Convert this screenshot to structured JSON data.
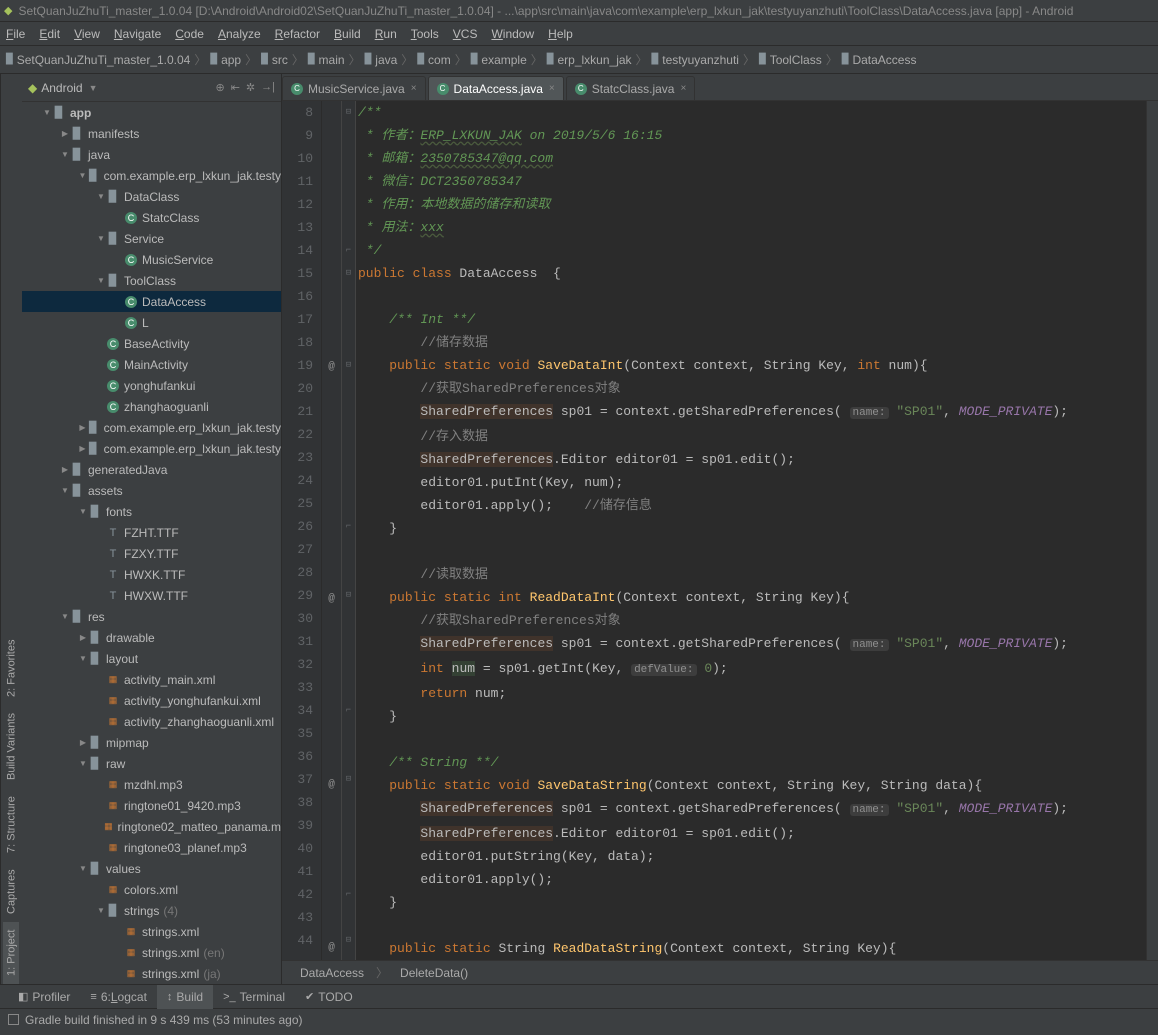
{
  "title": "SetQuanJuZhuTi_master_1.0.04 [D:\\Android\\Android02\\SetQuanJuZhuTi_master_1.0.04] - ...\\app\\src\\main\\java\\com\\example\\erp_lxkun_jak\\testyuyanzhuti\\ToolClass\\DataAccess.java [app] - Android",
  "menu": [
    "File",
    "Edit",
    "View",
    "Navigate",
    "Code",
    "Analyze",
    "Refactor",
    "Build",
    "Run",
    "Tools",
    "VCS",
    "Window",
    "Help"
  ],
  "breadcrumbs": [
    "SetQuanJuZhuTi_master_1.0.04",
    "app",
    "src",
    "main",
    "java",
    "com",
    "example",
    "erp_lxkun_jak",
    "testyuyanzhuti",
    "ToolClass",
    "DataAccess"
  ],
  "leftTabs": [
    "1: Project",
    "Captures",
    "7: Structure",
    "Build Variants",
    "2: Favorites"
  ],
  "projectDropdown": "Android",
  "tree": [
    {
      "d": 0,
      "a": "▼",
      "i": "app",
      "t": "app",
      "bold": true
    },
    {
      "d": 1,
      "a": "▶",
      "i": "folder",
      "t": "manifests"
    },
    {
      "d": 1,
      "a": "▼",
      "i": "folder",
      "t": "java"
    },
    {
      "d": 2,
      "a": "▼",
      "i": "folder",
      "t": "com.example.erp_lxkun_jak.testy"
    },
    {
      "d": 3,
      "a": "▼",
      "i": "folder",
      "t": "DataClass"
    },
    {
      "d": 4,
      "a": "",
      "i": "class",
      "t": "StatcClass"
    },
    {
      "d": 3,
      "a": "▼",
      "i": "folder",
      "t": "Service"
    },
    {
      "d": 4,
      "a": "",
      "i": "class",
      "t": "MusicService"
    },
    {
      "d": 3,
      "a": "▼",
      "i": "folder",
      "t": "ToolClass"
    },
    {
      "d": 4,
      "a": "",
      "i": "class",
      "t": "DataAccess",
      "sel": true
    },
    {
      "d": 4,
      "a": "",
      "i": "class",
      "t": "L"
    },
    {
      "d": 3,
      "a": "",
      "i": "class",
      "t": "BaseActivity"
    },
    {
      "d": 3,
      "a": "",
      "i": "class",
      "t": "MainActivity"
    },
    {
      "d": 3,
      "a": "",
      "i": "class",
      "t": "yonghufankui"
    },
    {
      "d": 3,
      "a": "",
      "i": "class",
      "t": "zhanghaoguanli"
    },
    {
      "d": 2,
      "a": "▶",
      "i": "folder",
      "t": "com.example.erp_lxkun_jak.testy"
    },
    {
      "d": 2,
      "a": "▶",
      "i": "folder",
      "t": "com.example.erp_lxkun_jak.testy"
    },
    {
      "d": 1,
      "a": "▶",
      "i": "folder",
      "t": "generatedJava"
    },
    {
      "d": 1,
      "a": "▼",
      "i": "folder",
      "t": "assets"
    },
    {
      "d": 2,
      "a": "▼",
      "i": "folder",
      "t": "fonts"
    },
    {
      "d": 3,
      "a": "",
      "i": "file",
      "t": "FZHT.TTF"
    },
    {
      "d": 3,
      "a": "",
      "i": "file",
      "t": "FZXY.TTF"
    },
    {
      "d": 3,
      "a": "",
      "i": "file",
      "t": "HWXK.TTF"
    },
    {
      "d": 3,
      "a": "",
      "i": "file",
      "t": "HWXW.TTF"
    },
    {
      "d": 1,
      "a": "▼",
      "i": "folder",
      "t": "res"
    },
    {
      "d": 2,
      "a": "▶",
      "i": "folder",
      "t": "drawable"
    },
    {
      "d": 2,
      "a": "▼",
      "i": "folder",
      "t": "layout"
    },
    {
      "d": 3,
      "a": "",
      "i": "res",
      "t": "activity_main.xml"
    },
    {
      "d": 3,
      "a": "",
      "i": "res",
      "t": "activity_yonghufankui.xml"
    },
    {
      "d": 3,
      "a": "",
      "i": "res",
      "t": "activity_zhanghaoguanli.xml"
    },
    {
      "d": 2,
      "a": "▶",
      "i": "folder",
      "t": "mipmap"
    },
    {
      "d": 2,
      "a": "▼",
      "i": "folder",
      "t": "raw"
    },
    {
      "d": 3,
      "a": "",
      "i": "res",
      "t": "mzdhl.mp3"
    },
    {
      "d": 3,
      "a": "",
      "i": "res",
      "t": "ringtone01_9420.mp3"
    },
    {
      "d": 3,
      "a": "",
      "i": "res",
      "t": "ringtone02_matteo_panama.m"
    },
    {
      "d": 3,
      "a": "",
      "i": "res",
      "t": "ringtone03_planef.mp3"
    },
    {
      "d": 2,
      "a": "▼",
      "i": "folder",
      "t": "values"
    },
    {
      "d": 3,
      "a": "",
      "i": "res",
      "t": "colors.xml"
    },
    {
      "d": 3,
      "a": "▼",
      "i": "folder",
      "t": "strings",
      "hint": "(4)"
    },
    {
      "d": 4,
      "a": "",
      "i": "res",
      "t": "strings.xml"
    },
    {
      "d": 4,
      "a": "",
      "i": "res",
      "t": "strings.xml",
      "hint": "(en)"
    },
    {
      "d": 4,
      "a": "",
      "i": "res",
      "t": "strings.xml",
      "hint": "(ja)"
    }
  ],
  "editorTabs": [
    {
      "name": "MusicService.java"
    },
    {
      "name": "DataAccess.java",
      "active": true
    },
    {
      "name": "StatcClass.java"
    }
  ],
  "code": {
    "lines": [
      8,
      9,
      10,
      11,
      12,
      13,
      14,
      15,
      16,
      17,
      18,
      19,
      20,
      21,
      22,
      23,
      24,
      25,
      26,
      27,
      28,
      29,
      30,
      31,
      32,
      33,
      34,
      35,
      36,
      37,
      38,
      39,
      40,
      41,
      42,
      43,
      44
    ],
    "marks": {
      "19": "@",
      "29": "@",
      "37": "@",
      "44": "@"
    },
    "folds": {
      "8": "⊟",
      "14": "⌐",
      "15": "⊟",
      "19": "⊟",
      "26": "⌐",
      "29": "⊟",
      "34": "⌐",
      "37": "⊟",
      "42": "⌐",
      "44": "⊟"
    },
    "raw": [
      {
        "n": 8,
        "h": "/**",
        "c": "javadoc"
      },
      {
        "n": 9,
        "h": " * 作者：<u1>ERP_LXKUN_JAK</u1> on 2019/5/6 16:15",
        "c": "javadoc"
      },
      {
        "n": 10,
        "h": " * 邮箱：<u1>2350785347@qq.com</u1>",
        "c": "javadoc"
      },
      {
        "n": 11,
        "h": " * 微信：DCT2350785347",
        "c": "javadoc"
      },
      {
        "n": 12,
        "h": " * 作用：本地数据的储存和读取",
        "c": "javadoc"
      },
      {
        "n": 13,
        "h": " * 用法：<u1>xxx</u1>",
        "c": "javadoc"
      },
      {
        "n": 14,
        "h": " */",
        "c": "javadoc"
      },
      {
        "n": 15,
        "h": "<kw>public class</kw> DataAccess  {"
      },
      {
        "n": 16,
        "h": ""
      },
      {
        "n": 17,
        "h": "    <jd>/** Int **/</jd>"
      },
      {
        "n": 18,
        "h": "        <cm>//储存数据</cm>"
      },
      {
        "n": 19,
        "h": "    <kw>public static void</kw> <m>SaveDataInt</m>(Context context, String Key, <kw>int</kw> num){"
      },
      {
        "n": 20,
        "h": "        <cm>//获取SharedPreferences对象</cm>"
      },
      {
        "n": 21,
        "h": "        <hl>SharedPreferences</hl> sp01 = context.getSharedPreferences( <ph>name:</ph> <s>\"SP01\"</s>, <ci>MODE_PRIVATE</ci>);"
      },
      {
        "n": 22,
        "h": "        <cm>//存入数据</cm>"
      },
      {
        "n": 23,
        "h": "        <hl>SharedPreferences</hl>.Editor editor01 = sp01.edit();"
      },
      {
        "n": 24,
        "h": "        editor01.putInt(Key, num);"
      },
      {
        "n": 25,
        "h": "        editor01.apply();    <cm>//储存信息</cm>"
      },
      {
        "n": 26,
        "h": "    }"
      },
      {
        "n": 27,
        "h": ""
      },
      {
        "n": 28,
        "h": "        <cm>//读取数据</cm>"
      },
      {
        "n": 29,
        "h": "    <kw>public static int</kw> <m>ReadDataInt</m>(Context context, String Key){"
      },
      {
        "n": 30,
        "h": "        <cm>//获取SharedPreferences对象</cm>"
      },
      {
        "n": 31,
        "h": "        <hl>SharedPreferences</hl> sp01 = context.getSharedPreferences( <ph>name:</ph> <s>\"SP01\"</s>, <ci>MODE_PRIVATE</ci>);"
      },
      {
        "n": 32,
        "h": "        <kw>int</kw> <vh>num</vh> = sp01.getInt(Key, <ph>defValue:</ph> <s>0</s>);"
      },
      {
        "n": 33,
        "h": "        <kw>return</kw> num;"
      },
      {
        "n": 34,
        "h": "    }"
      },
      {
        "n": 35,
        "h": ""
      },
      {
        "n": 36,
        "h": "    <jd>/** String **/</jd>"
      },
      {
        "n": 37,
        "h": "    <kw>public static void</kw> <m>SaveDataString</m>(Context context, String Key, String data){"
      },
      {
        "n": 38,
        "h": "        <hl>SharedPreferences</hl> sp01 = context.getSharedPreferences( <ph>name:</ph> <s>\"SP01\"</s>, <ci>MODE_PRIVATE</ci>);"
      },
      {
        "n": 39,
        "h": "        <hl>SharedPreferences</hl>.Editor editor01 = sp01.edit();"
      },
      {
        "n": 40,
        "h": "        editor01.putString(Key, data);"
      },
      {
        "n": 41,
        "h": "        editor01.apply();"
      },
      {
        "n": 42,
        "h": "    }"
      },
      {
        "n": 43,
        "h": ""
      },
      {
        "n": 44,
        "h": "    <kw>public static</kw> String <m>ReadDataString</m>(Context context, String Key){"
      }
    ]
  },
  "editorBreadcrumb": [
    "DataAccess",
    "DeleteData()"
  ],
  "bottomTabs": [
    {
      "icon": "◧",
      "label": "Profiler"
    },
    {
      "icon": "≡",
      "label": "6: Logcat"
    },
    {
      "icon": "↕",
      "label": "Build",
      "active": true
    },
    {
      "icon": ">_",
      "label": "Terminal"
    },
    {
      "icon": "✔",
      "label": "TODO"
    }
  ],
  "status": "Gradle build finished in 9 s 439 ms (53 minutes ago)"
}
